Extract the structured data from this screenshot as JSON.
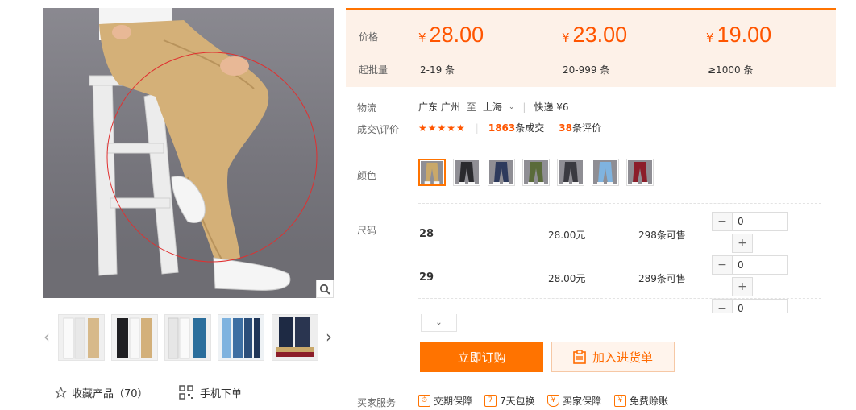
{
  "price_table": {
    "price_label": "价格",
    "moq_label": "起批量",
    "currency": "¥",
    "tiers": [
      {
        "price": "28.00",
        "quantity": "2-19 条"
      },
      {
        "price": "23.00",
        "quantity": "20-999 条"
      },
      {
        "price": "19.00",
        "quantity": "≥1000 条"
      }
    ]
  },
  "logistics": {
    "label": "物流",
    "from": "广东 广州",
    "to_word": "至",
    "to": "上海",
    "express": "快递 ¥6"
  },
  "deals": {
    "label": "成交\\评价",
    "rating_stars": 5,
    "deal_count": "1863",
    "deal_suffix": "条成交",
    "review_count": "38",
    "review_suffix": "条评价"
  },
  "color_label": "颜色",
  "colors": [
    {
      "name": "khaki",
      "hex": "#c9a86a",
      "selected": true
    },
    {
      "name": "black",
      "hex": "#2a2a2e"
    },
    {
      "name": "navy",
      "hex": "#2d3a5c"
    },
    {
      "name": "army-green",
      "hex": "#5a6b3a"
    },
    {
      "name": "dark-grey",
      "hex": "#3a3a40"
    },
    {
      "name": "light-blue",
      "hex": "#7fb3df"
    },
    {
      "name": "burgundy",
      "hex": "#8c1e2a"
    }
  ],
  "size_label": "尺码",
  "sizes": [
    {
      "size": "28",
      "price": "28.00元",
      "stock": "298条可售",
      "qty": "0"
    },
    {
      "size": "29",
      "price": "28.00元",
      "stock": "289条可售",
      "qty": "0"
    },
    {
      "size": "",
      "price": "",
      "stock": "",
      "qty": "0"
    }
  ],
  "actions": {
    "order_label": "立即订购",
    "cart_label": "加入进货单"
  },
  "favorite": {
    "label": "收藏产品（70）"
  },
  "mobile_order": {
    "label": "手机下单"
  },
  "services": {
    "label": "买家服务",
    "items": [
      {
        "label": "交期保障",
        "icon": "clock-shield-icon"
      },
      {
        "label": "7天包换",
        "icon": "seven-days-icon"
      },
      {
        "label": "买家保障",
        "icon": "shield-icon"
      },
      {
        "label": "免费赊账",
        "icon": "credit-icon"
      }
    ]
  },
  "thumbnails": [
    {
      "name": "white-pants"
    },
    {
      "name": "black-khaki-pants"
    },
    {
      "name": "grey-white-pants"
    },
    {
      "name": "blue-pants"
    },
    {
      "name": "navy-pants"
    }
  ],
  "accent_color": "#ff7300"
}
